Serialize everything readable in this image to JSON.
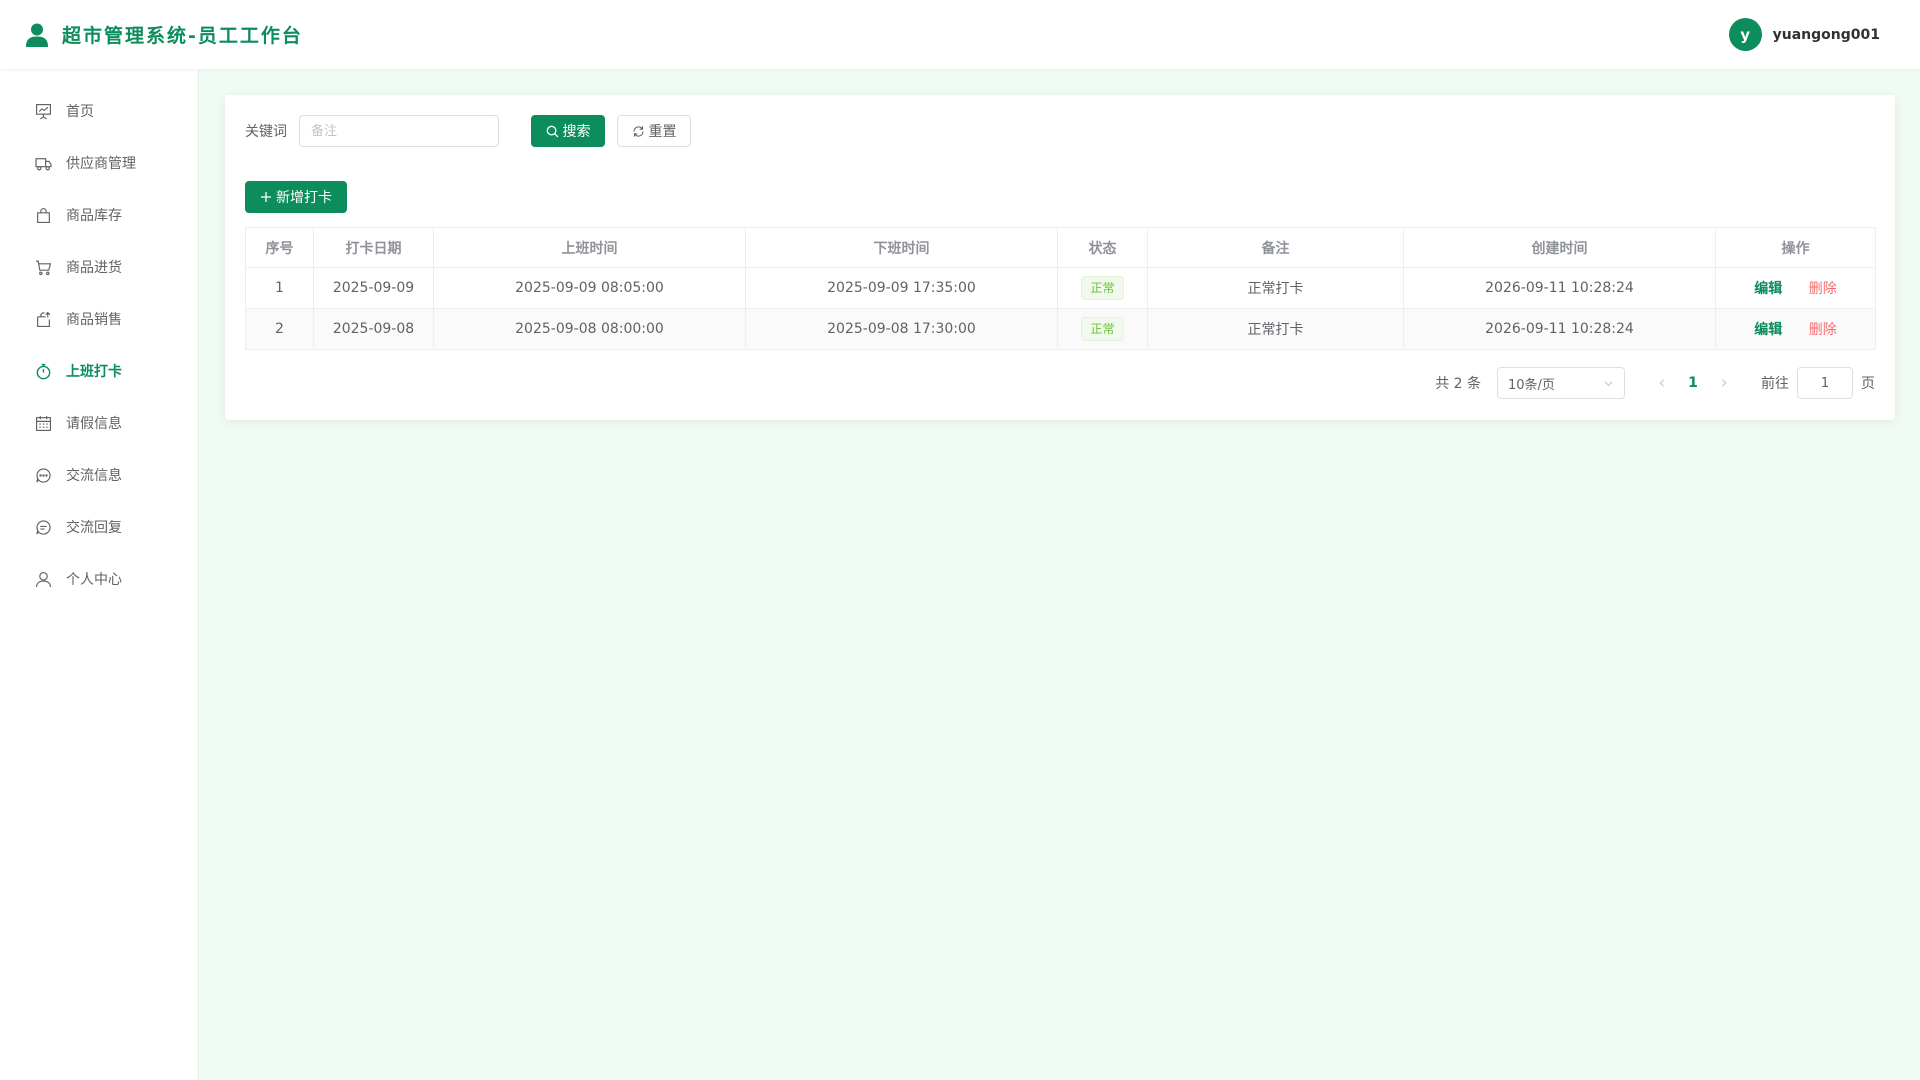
{
  "header": {
    "title": "超市管理系统-员工工作台",
    "user_initial": "y",
    "username": "yuangong001"
  },
  "sidebar": {
    "items": [
      {
        "label": "首页",
        "icon": "presentation-board-icon"
      },
      {
        "label": "供应商管理",
        "icon": "truck-icon"
      },
      {
        "label": "商品库存",
        "icon": "shopping-bag-icon"
      },
      {
        "label": "商品进货",
        "icon": "shopping-cart-icon"
      },
      {
        "label": "商品销售",
        "icon": "sell-bag-icon"
      },
      {
        "label": "上班打卡",
        "icon": "stopwatch-icon",
        "active": true
      },
      {
        "label": "请假信息",
        "icon": "calendar-icon"
      },
      {
        "label": "交流信息",
        "icon": "chat-dots-icon"
      },
      {
        "label": "交流回复",
        "icon": "chat-reply-icon"
      },
      {
        "label": "个人中心",
        "icon": "user-icon"
      }
    ]
  },
  "search": {
    "label": "关键词",
    "placeholder": "备注",
    "value": "",
    "search_label": "搜索",
    "reset_label": "重置"
  },
  "toolbar": {
    "add_label": "新增打卡"
  },
  "table": {
    "headers": [
      "序号",
      "打卡日期",
      "上班时间",
      "下班时间",
      "状态",
      "备注",
      "创建时间",
      "操作"
    ],
    "rows": [
      {
        "index": "1",
        "date": "2025-09-09",
        "clock_in": "2025-09-09 08:05:00",
        "clock_out": "2025-09-09 17:35:00",
        "status": "正常",
        "note": "正常打卡",
        "created": "2026-09-11 10:28:24"
      },
      {
        "index": "2",
        "date": "2025-09-08",
        "clock_in": "2025-09-08 08:00:00",
        "clock_out": "2025-09-08 17:30:00",
        "status": "正常",
        "note": "正常打卡",
        "created": "2026-09-11 10:28:24"
      }
    ],
    "edit_label": "编辑",
    "delete_label": "删除"
  },
  "pagination": {
    "total_text": "共 2 条",
    "page_size": "10条/页",
    "current_page": "1",
    "goto_label": "前往",
    "goto_value": "1",
    "page_suffix": "页"
  },
  "colors": {
    "primary": "#0d8c5c",
    "danger": "#f56c6c",
    "success_tag": "#67c23a",
    "page_background": "#f0fbf3"
  }
}
